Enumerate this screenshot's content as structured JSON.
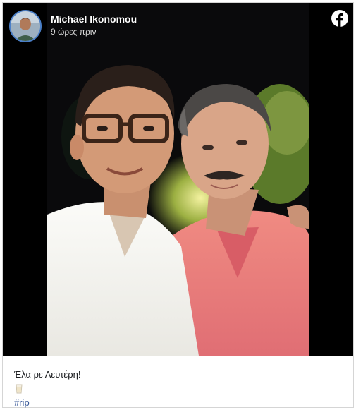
{
  "post": {
    "author_name": "Michael Ikonomou",
    "timestamp": "9 ώρες πριν",
    "caption": "Έλα ρε Λευτέρη!",
    "emoji": "drink-glass",
    "hashtag": "#rip",
    "platform_icon": "facebook-icon"
  },
  "colors": {
    "hashtag": "#385898",
    "avatar_ring": "#4a7fc8",
    "pink_shirt": "#e87a7a"
  }
}
